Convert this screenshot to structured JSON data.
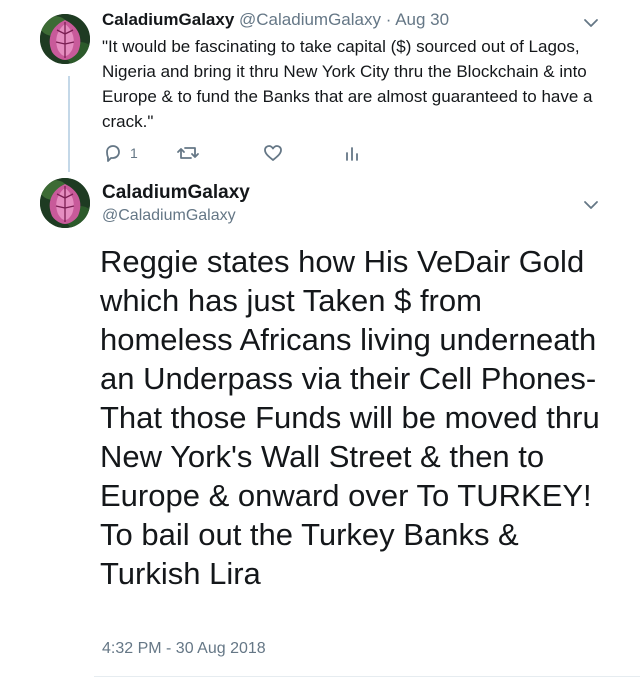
{
  "tweet1": {
    "display_name": "CaladiumGalaxy",
    "handle": "@CaladiumGalaxy",
    "separator": "·",
    "date": "Aug 30",
    "text": "\"It would be fascinating to take capital ($) sourced out of Lagos, Nigeria and bring it thru New York City thru the Blockchain & into Europe & to fund the Banks that are almost guaranteed to have a crack.\"",
    "actions": {
      "reply_icon": "reply-icon",
      "reply_count": "1",
      "retweet_icon": "retweet-icon",
      "like_icon": "heart-icon",
      "analytics_icon": "analytics-icon"
    }
  },
  "tweet2": {
    "display_name": "CaladiumGalaxy",
    "handle": "@CaladiumGalaxy",
    "text": "Reggie states how His VeDair Gold which has just Taken $ from homeless Africans living underneath an Underpass via their Cell Phones- That those Funds will be moved thru New York's Wall Street & then to Europe & onward over To TURKEY! To bail out the Turkey Banks & Turkish Lira",
    "timestamp": "4:32 PM - 30 Aug 2018"
  },
  "colors": {
    "text": "#14171a",
    "muted": "#657786",
    "thread_line": "#c4d8e8",
    "divider": "#e6ecf0"
  }
}
